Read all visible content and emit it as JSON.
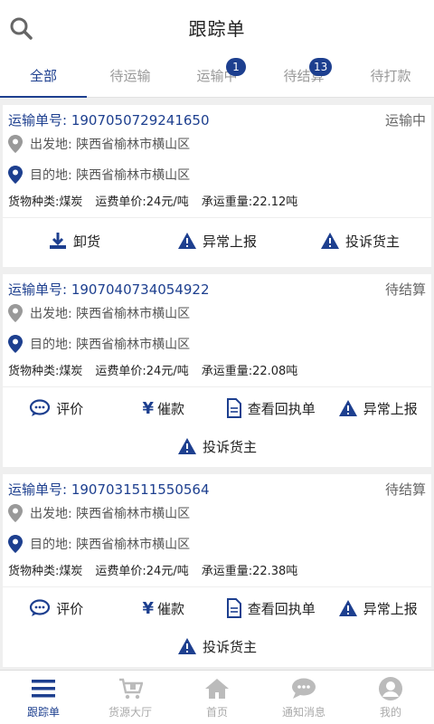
{
  "header": {
    "title": "跟踪单"
  },
  "tabs": [
    {
      "label": "全部",
      "badge": ""
    },
    {
      "label": "待运输",
      "badge": ""
    },
    {
      "label": "运输中",
      "badge": "1"
    },
    {
      "label": "待结算",
      "badge": "13"
    },
    {
      "label": "待打款",
      "badge": ""
    }
  ],
  "orders": [
    {
      "order_no": "运输单号: 1907050729241650",
      "status": "运输中",
      "origin": "出发地: 陕西省榆林市横山区",
      "destination": "目的地: 陕西省榆林市横山区",
      "cargo": "货物种类:煤炭",
      "price": "运费单价:24元/吨",
      "weight": "承运重量:22.12吨",
      "actions": [
        "卸货",
        "异常上报",
        "投诉货主"
      ]
    },
    {
      "order_no": "运输单号: 1907040734054922",
      "status": "待结算",
      "origin": "出发地: 陕西省榆林市横山区",
      "destination": "目的地: 陕西省榆林市横山区",
      "cargo": "货物种类:煤炭",
      "price": "运费单价:24元/吨",
      "weight": "承运重量:22.08吨",
      "actions": [
        "评价",
        "催款",
        "查看回执单",
        "异常上报",
        "投诉货主"
      ]
    },
    {
      "order_no": "运输单号: 1907031511550564",
      "status": "待结算",
      "origin": "出发地: 陕西省榆林市横山区",
      "destination": "目的地: 陕西省榆林市横山区",
      "cargo": "货物种类:煤炭",
      "price": "运费单价:24元/吨",
      "weight": "承运重量:22.38吨",
      "actions": [
        "评价",
        "催款",
        "查看回执单",
        "异常上报",
        "投诉货主"
      ]
    }
  ],
  "tabbar": [
    {
      "label": "跟踪单",
      "icon": "list-icon"
    },
    {
      "label": "货源大厅",
      "icon": "cart-icon"
    },
    {
      "label": "首页",
      "icon": "home-icon"
    },
    {
      "label": "通知消息",
      "icon": "message-icon"
    },
    {
      "label": "我的",
      "icon": "user-icon"
    }
  ],
  "colors": {
    "primary": "#1d3f8f",
    "muted": "#aaaaaa",
    "background": "#efefef"
  }
}
